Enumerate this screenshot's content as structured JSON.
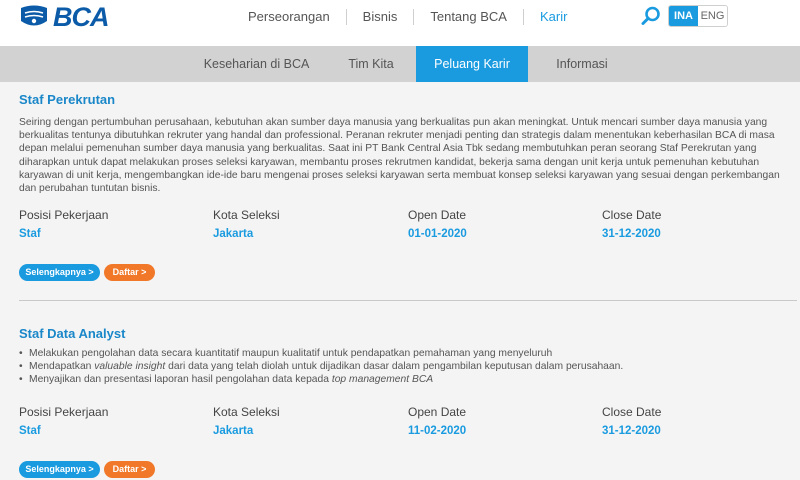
{
  "header": {
    "logo_text": "BCA",
    "nav": [
      {
        "label": "Perseorangan"
      },
      {
        "label": "Bisnis"
      },
      {
        "label": "Tentang BCA"
      },
      {
        "label": "Karir"
      }
    ],
    "active_nav": "Karir",
    "search_icon": "search-icon",
    "lang": {
      "active": "INA",
      "other": "ENG"
    }
  },
  "subnav": {
    "tabs": [
      {
        "label": "Keseharian di BCA"
      },
      {
        "label": "Tim Kita"
      },
      {
        "label": "Peluang Karir"
      },
      {
        "label": "Informasi"
      }
    ],
    "active_tab": "Peluang Karir"
  },
  "colors": {
    "accent": "#1a9be0",
    "brand": "#0b5ba8",
    "orange": "#f07828",
    "subnav_bg": "#d2d2d2",
    "content_bg": "#f4f4f4"
  },
  "jobs": [
    {
      "title": "Staf Perekrutan",
      "description": "Seiring dengan pertumbuhan perusahaan, kebutuhan akan sumber daya manusia yang berkualitas pun akan meningkat. Untuk mencari sumber daya manusia yang berkualitas tentunya dibutuhkan rekruter yang handal dan professional. Peranan rekruter menjadi penting dan strategis dalam menentukan keberhasilan BCA di masa depan melalui pemenuhan sumber daya manusia yang berkualitas. Saat ini PT Bank Central Asia Tbk sedang membutuhkan peran seorang Staf Perekrutan yang diharapkan untuk dapat melakukan proses seleksi karyawan, membantu proses rekrutmen kandidat, bekerja sama dengan unit kerja untuk pemenuhan kebutuhan karyawan di unit kerja, mengembangkan ide-ide baru mengenai proses seleksi karyawan serta membuat konsep seleksi karyawan yang sesuai dengan perkembangan dan perubahan tuntutan bisnis.",
      "labels": {
        "position": "Posisi Pekerjaan",
        "city": "Kota Seleksi",
        "open": "Open Date",
        "close": "Close Date"
      },
      "position": "Staf",
      "city": "Jakarta",
      "open_date": "01-01-2020",
      "close_date": "31-12-2020",
      "more_label": "Selengkapnya >",
      "apply_label": "Daftar >"
    },
    {
      "title": "Staf Data Analyst",
      "bullets": [
        "Melakukan pengolahan data secara kuantitatif maupun kualitatif untuk pendapatkan pemahaman yang menyeluruh",
        "Mendapatkan valuable insight dari data yang telah diolah untuk dijadikan dasar dalam pengambilan keputusan dalam perusahaan.",
        "Menyajikan dan presentasi laporan hasil pengolahan data kepada top management BCA"
      ],
      "labels": {
        "position": "Posisi Pekerjaan",
        "city": "Kota Seleksi",
        "open": "Open Date",
        "close": "Close Date"
      },
      "position": "Staf",
      "city": "Jakarta",
      "open_date": "11-02-2020",
      "close_date": "31-12-2020",
      "more_label": "Selengkapnya >",
      "apply_label": "Daftar >"
    }
  ]
}
